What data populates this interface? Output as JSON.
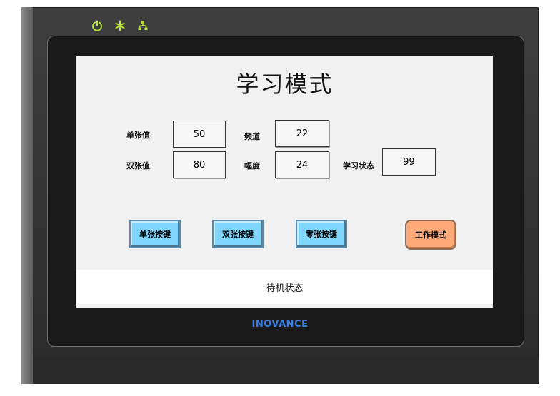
{
  "screen": {
    "title": "学习模式",
    "fields": [
      {
        "label": "单张值",
        "value": "50"
      },
      {
        "label": "频道",
        "value": "22"
      },
      {
        "label": "双张值",
        "value": "80"
      },
      {
        "label": "幅度",
        "value": "24"
      },
      {
        "label": "学习状态",
        "value": "99"
      }
    ],
    "buttons": {
      "single": "单张按键",
      "double": "双张按键",
      "zero": "零张按键",
      "work_mode": "工作模式"
    },
    "status": "待机状态"
  },
  "device": {
    "brand": "INOVANCE",
    "indicator_icons": [
      "power-icon",
      "snowflake-icon",
      "network-icon"
    ]
  },
  "colors": {
    "button_blue": "#7fd5fb",
    "button_orange": "#ffaa78",
    "indicator": "#b8e23a",
    "brand": "#3a7fe6"
  }
}
